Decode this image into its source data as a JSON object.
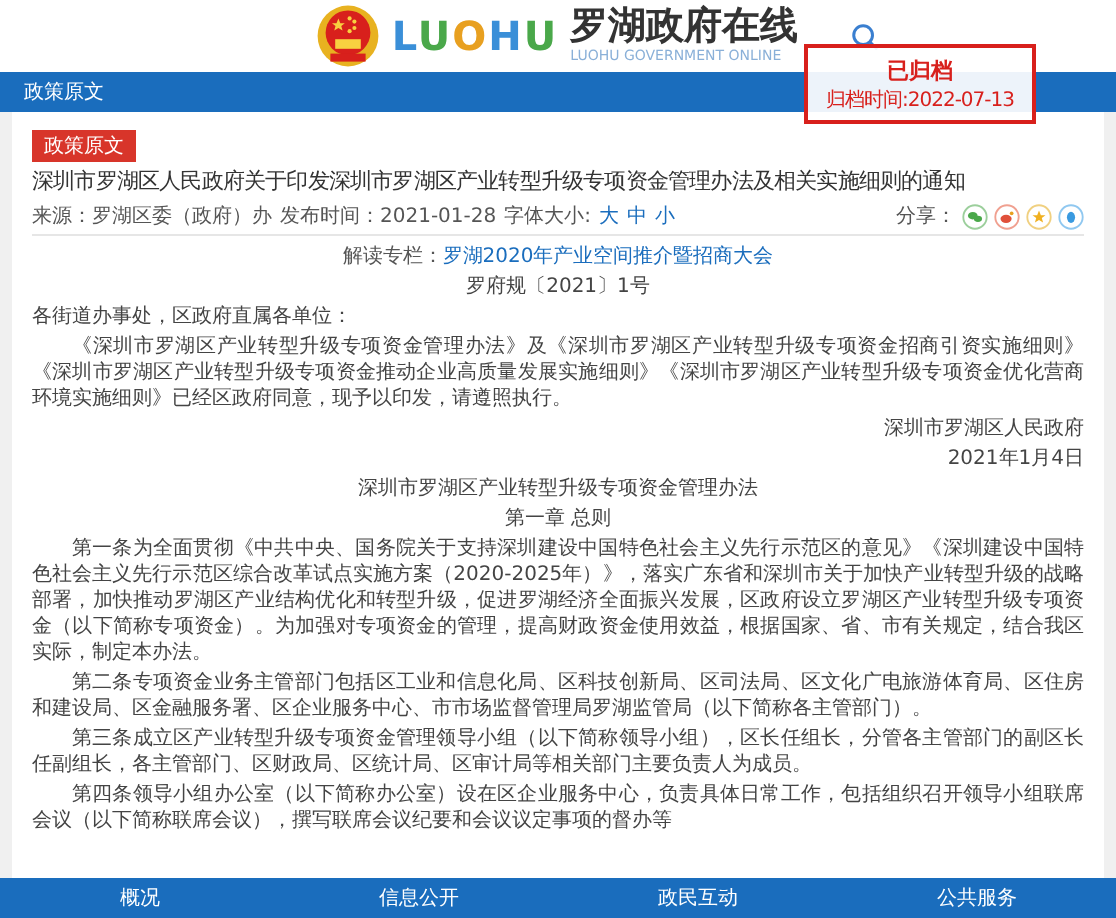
{
  "header": {
    "logo_latin": "LUOHU",
    "logo_title": "罗湖政府在线",
    "logo_subtitle": "LUOHU GOVERNMENT ONLINE"
  },
  "stamp": {
    "title": "已归档",
    "date": "归档时间:2022-07-13"
  },
  "section_bar": {
    "label": "政策原文"
  },
  "article": {
    "category": "政策原文",
    "title": "深圳市罗湖区人民政府关于印发深圳市罗湖区产业转型升级专项资金管理办法及相关实施细则的通知",
    "meta": {
      "source": "来源：罗湖区委（政府）办",
      "published": "发布时间：2021-01-28",
      "font_size_label": "字体大小:",
      "font_sizes": [
        "大",
        "中",
        "小"
      ],
      "share_label": "分享："
    },
    "column": {
      "label": "解读专栏：",
      "link": "罗湖2020年产业空间推介暨招商大会"
    },
    "body": [
      {
        "kind": "center",
        "text": "罗府规〔2021〕1号"
      },
      {
        "kind": "plain",
        "text": "各街道办事处，区政府直属各单位："
      },
      {
        "kind": "para",
        "text": "《深圳市罗湖区产业转型升级专项资金管理办法》及《深圳市罗湖区产业转型升级专项资金招商引资实施细则》《深圳市罗湖区产业转型升级专项资金推动企业高质量发展实施细则》《深圳市罗湖区产业转型升级专项资金优化营商环境实施细则》已经区政府同意，现予以印发，请遵照执行。"
      },
      {
        "kind": "right",
        "text": "深圳市罗湖区人民政府"
      },
      {
        "kind": "right",
        "text": "2021年1月4日"
      },
      {
        "kind": "center",
        "text": "深圳市罗湖区产业转型升级专项资金管理办法"
      },
      {
        "kind": "center",
        "text": "第一章 总则"
      },
      {
        "kind": "para",
        "text": "第一条为全面贯彻《中共中央、国务院关于支持深圳建设中国特色社会主义先行示范区的意见》《深圳建设中国特色社会主义先行示范区综合改革试点实施方案（2020-2025年）》，落实广东省和深圳市关于加快产业转型升级的战略部署，加快推动罗湖区产业结构优化和转型升级，促进罗湖经济全面振兴发展，区政府设立罗湖区产业转型升级专项资金（以下简称专项资金）。为加强对专项资金的管理，提高财政资金使用效益，根据国家、省、市有关规定，结合我区实际，制定本办法。"
      },
      {
        "kind": "para",
        "text": "第二条专项资金业务主管部门包括区工业和信息化局、区科技创新局、区司法局、区文化广电旅游体育局、区住房和建设局、区金融服务署、区企业服务中心、市市场监督管理局罗湖监管局（以下简称各主管部门）。"
      },
      {
        "kind": "para",
        "text": "第三条成立区产业转型升级专项资金管理领导小组（以下简称领导小组），区长任组长，分管各主管部门的副区长任副组长，各主管部门、区财政局、区统计局、区审计局等相关部门主要负责人为成员。"
      },
      {
        "kind": "para",
        "text": "第四条领导小组办公室（以下简称办公室）设在区企业服务中心，负责具体日常工作，包括组织召开领导小组联席会议（以下简称联席会议），撰写联席会议纪要和会议议定事项的督办等"
      }
    ]
  },
  "footer_nav": [
    {
      "label": "概况"
    },
    {
      "label": "信息公开"
    },
    {
      "label": "政民互动"
    },
    {
      "label": "公共服务"
    }
  ]
}
